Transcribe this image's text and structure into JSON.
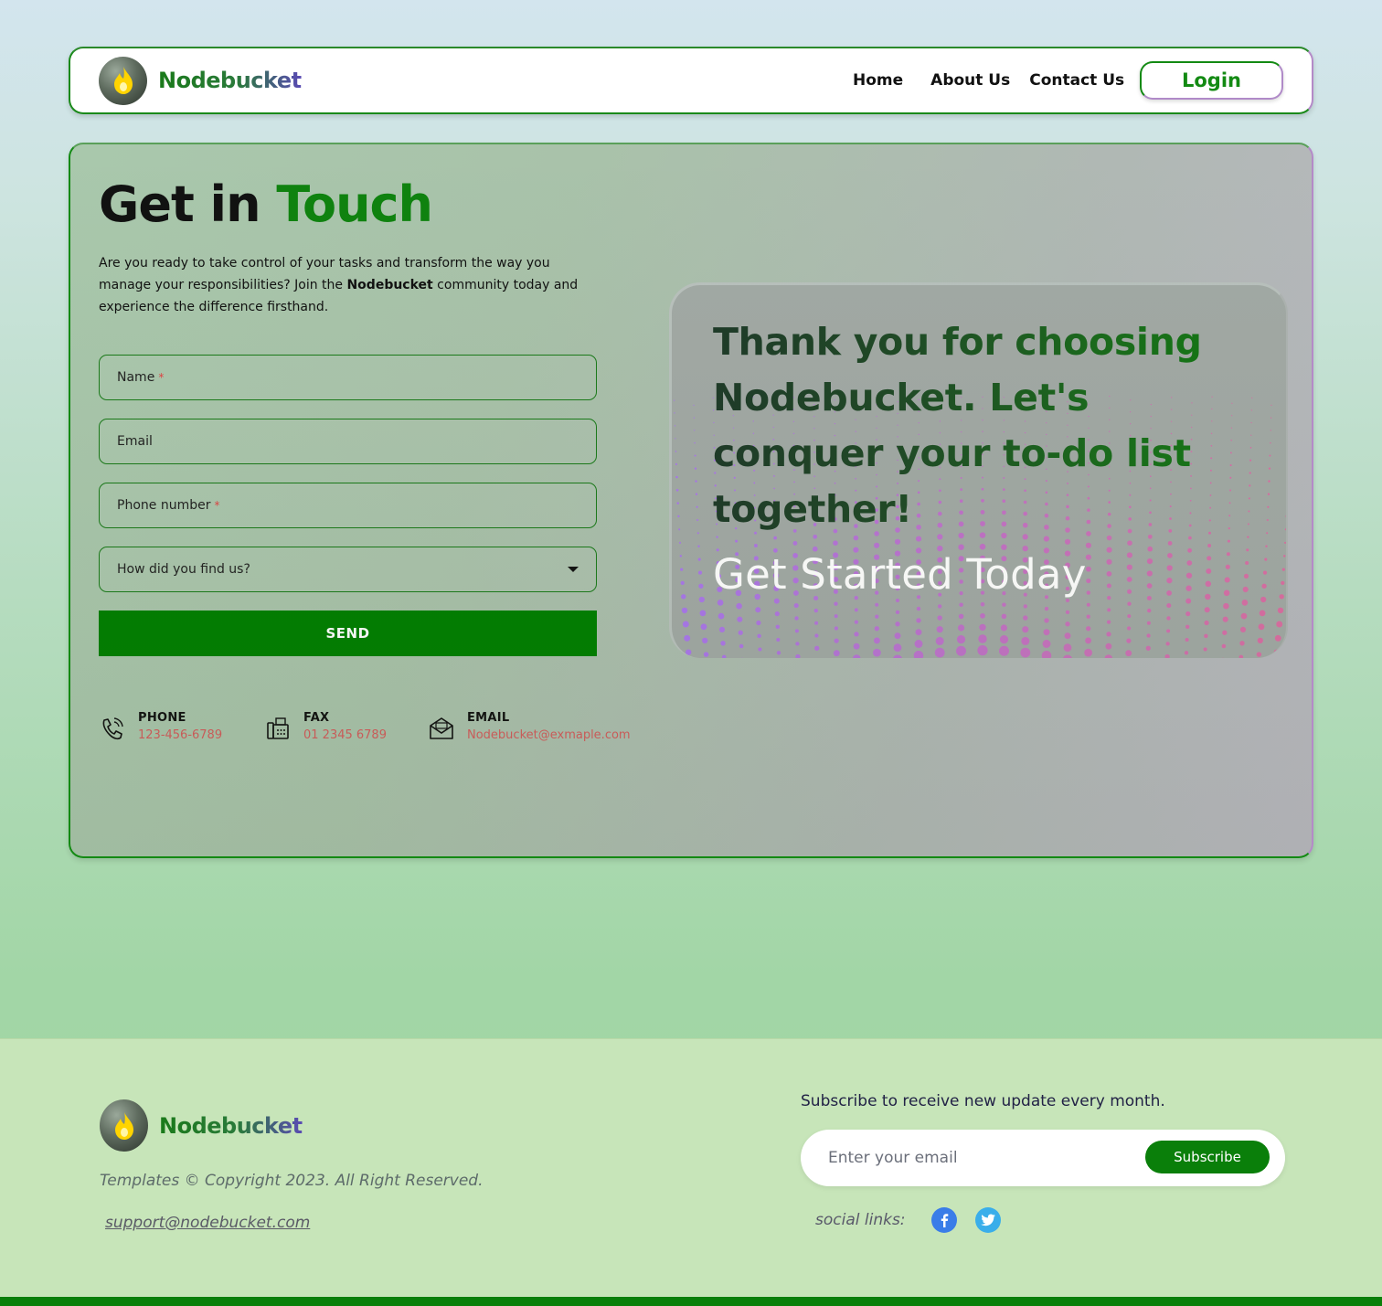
{
  "brand": {
    "name": "Nodebucket"
  },
  "nav": {
    "links": [
      "Home",
      "About Us",
      "Contact Us"
    ],
    "login": "Login"
  },
  "contact": {
    "title_main": "Get in",
    "title_accent": "Touch",
    "intro_before": "Are you ready to take control of your tasks and transform the way you manage your responsibilities? Join the ",
    "intro_bold": "Nodebucket",
    "intro_after": " community today and experience the difference firsthand.",
    "form": {
      "name": "Name",
      "email": "Email",
      "phone": "Phone number",
      "source": "How did you find us?",
      "required_mark": "*",
      "send": "SEND"
    },
    "info": [
      {
        "label": "PHONE",
        "value": "123-456-6789",
        "icon": "phone-icon"
      },
      {
        "label": "FAX",
        "value": "01 2345 6789",
        "icon": "fax-icon"
      },
      {
        "label": "EMAIL",
        "value": "Nodebucket@exmaple.com",
        "icon": "mail-icon"
      }
    ]
  },
  "card": {
    "message": "Thank you for choosing Nodebucket. Let's conquer your to-do list together!",
    "cta": "Get Started Today"
  },
  "footer": {
    "copyright": "Templates © Copyright 2023. All Right Reserved.",
    "support": "support@nodebucket.com",
    "subscribe_title": "Subscribe to receive new update every month.",
    "email_placeholder": "Enter your email",
    "subscribe_button": "Subscribe",
    "social_label": "social links:",
    "social_icons": [
      "facebook-icon",
      "twitter-icon"
    ]
  },
  "colors": {
    "brand_green": "#0f820f",
    "accent_red": "#d25c5c",
    "footer_bg": "#c7e5b9"
  }
}
